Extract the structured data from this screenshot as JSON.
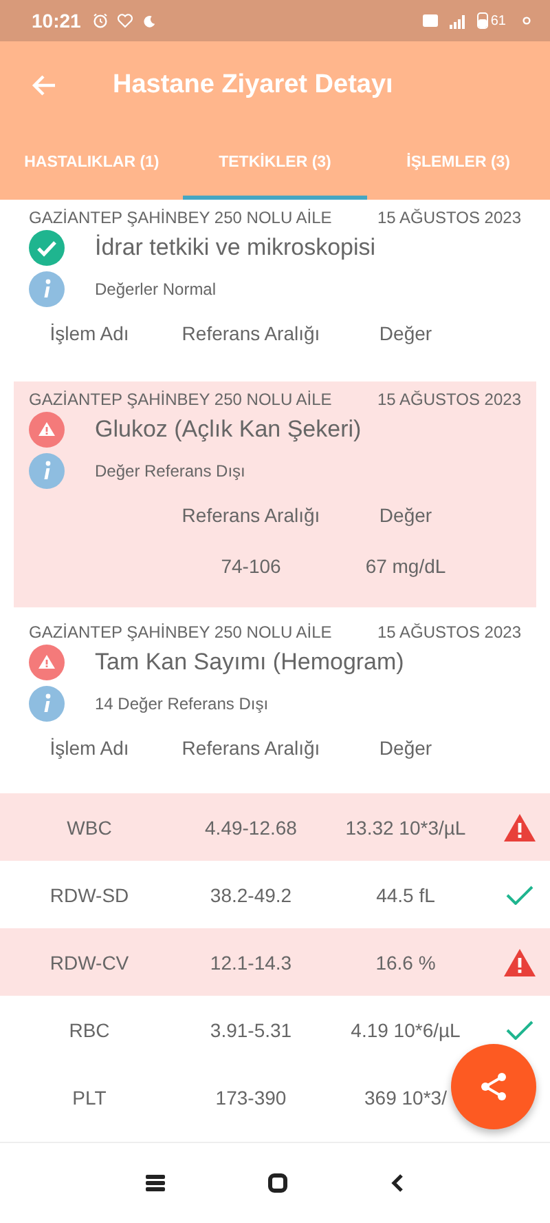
{
  "status_bar": {
    "time": "10:21",
    "battery": "61"
  },
  "app_bar": {
    "title": "Hastane Ziyaret Detayı"
  },
  "tabs": [
    {
      "label": "HASTALIKLAR (1)",
      "selected": false
    },
    {
      "label": "TETKİKLER (3)",
      "selected": true
    },
    {
      "label": "İŞLEMLER (3)",
      "selected": false
    }
  ],
  "tests": [
    {
      "facility": "GAZİANTEP ŞAHİNBEY 250 NOLU AİLE",
      "date": "15 AĞUSTOS 2023",
      "name": "İdrar tetkiki ve mikroskopisi",
      "out_of_range": false,
      "note": "Değerler Normal",
      "header": {
        "name": "İşlem Adı",
        "range": "Referans Aralığı",
        "value": "Değer"
      }
    },
    {
      "facility": "GAZİANTEP ŞAHİNBEY 250 NOLU AİLE",
      "date": "15 AĞUSTOS 2023",
      "name": "Glukoz (Açlık Kan Şekeri)",
      "out_of_range": true,
      "note": "Değer Referans Dışı",
      "header": {
        "range": "Referans Aralığı",
        "value": "Değer"
      },
      "rows": [
        {
          "range": "74-106",
          "value": "67 mg/dL"
        }
      ]
    },
    {
      "facility": "GAZİANTEP ŞAHİNBEY 250 NOLU AİLE",
      "date": "15 AĞUSTOS 2023",
      "name": "Tam Kan Sayımı (Hemogram)",
      "out_of_range": true,
      "note": "14 Değer Referans Dışı",
      "header": {
        "name": "İşlem Adı",
        "range": "Referans Aralığı",
        "value": "Değer"
      },
      "rows": [
        {
          "name": "WBC",
          "range": "4.49-12.68",
          "value": "13.32 10*3/µL",
          "out_of_range": true
        },
        {
          "name": "RDW-SD",
          "range": "38.2-49.2",
          "value": "44.5 fL",
          "out_of_range": false
        },
        {
          "name": "RDW-CV",
          "range": "12.1-14.3",
          "value": "16.6 %",
          "out_of_range": true
        },
        {
          "name": "RBC",
          "range": "3.91-5.31",
          "value": "4.19 10*6/µL",
          "out_of_range": false
        },
        {
          "name": "PLT",
          "range": "173-390",
          "value": "369 10*3/"
        }
      ]
    }
  ]
}
